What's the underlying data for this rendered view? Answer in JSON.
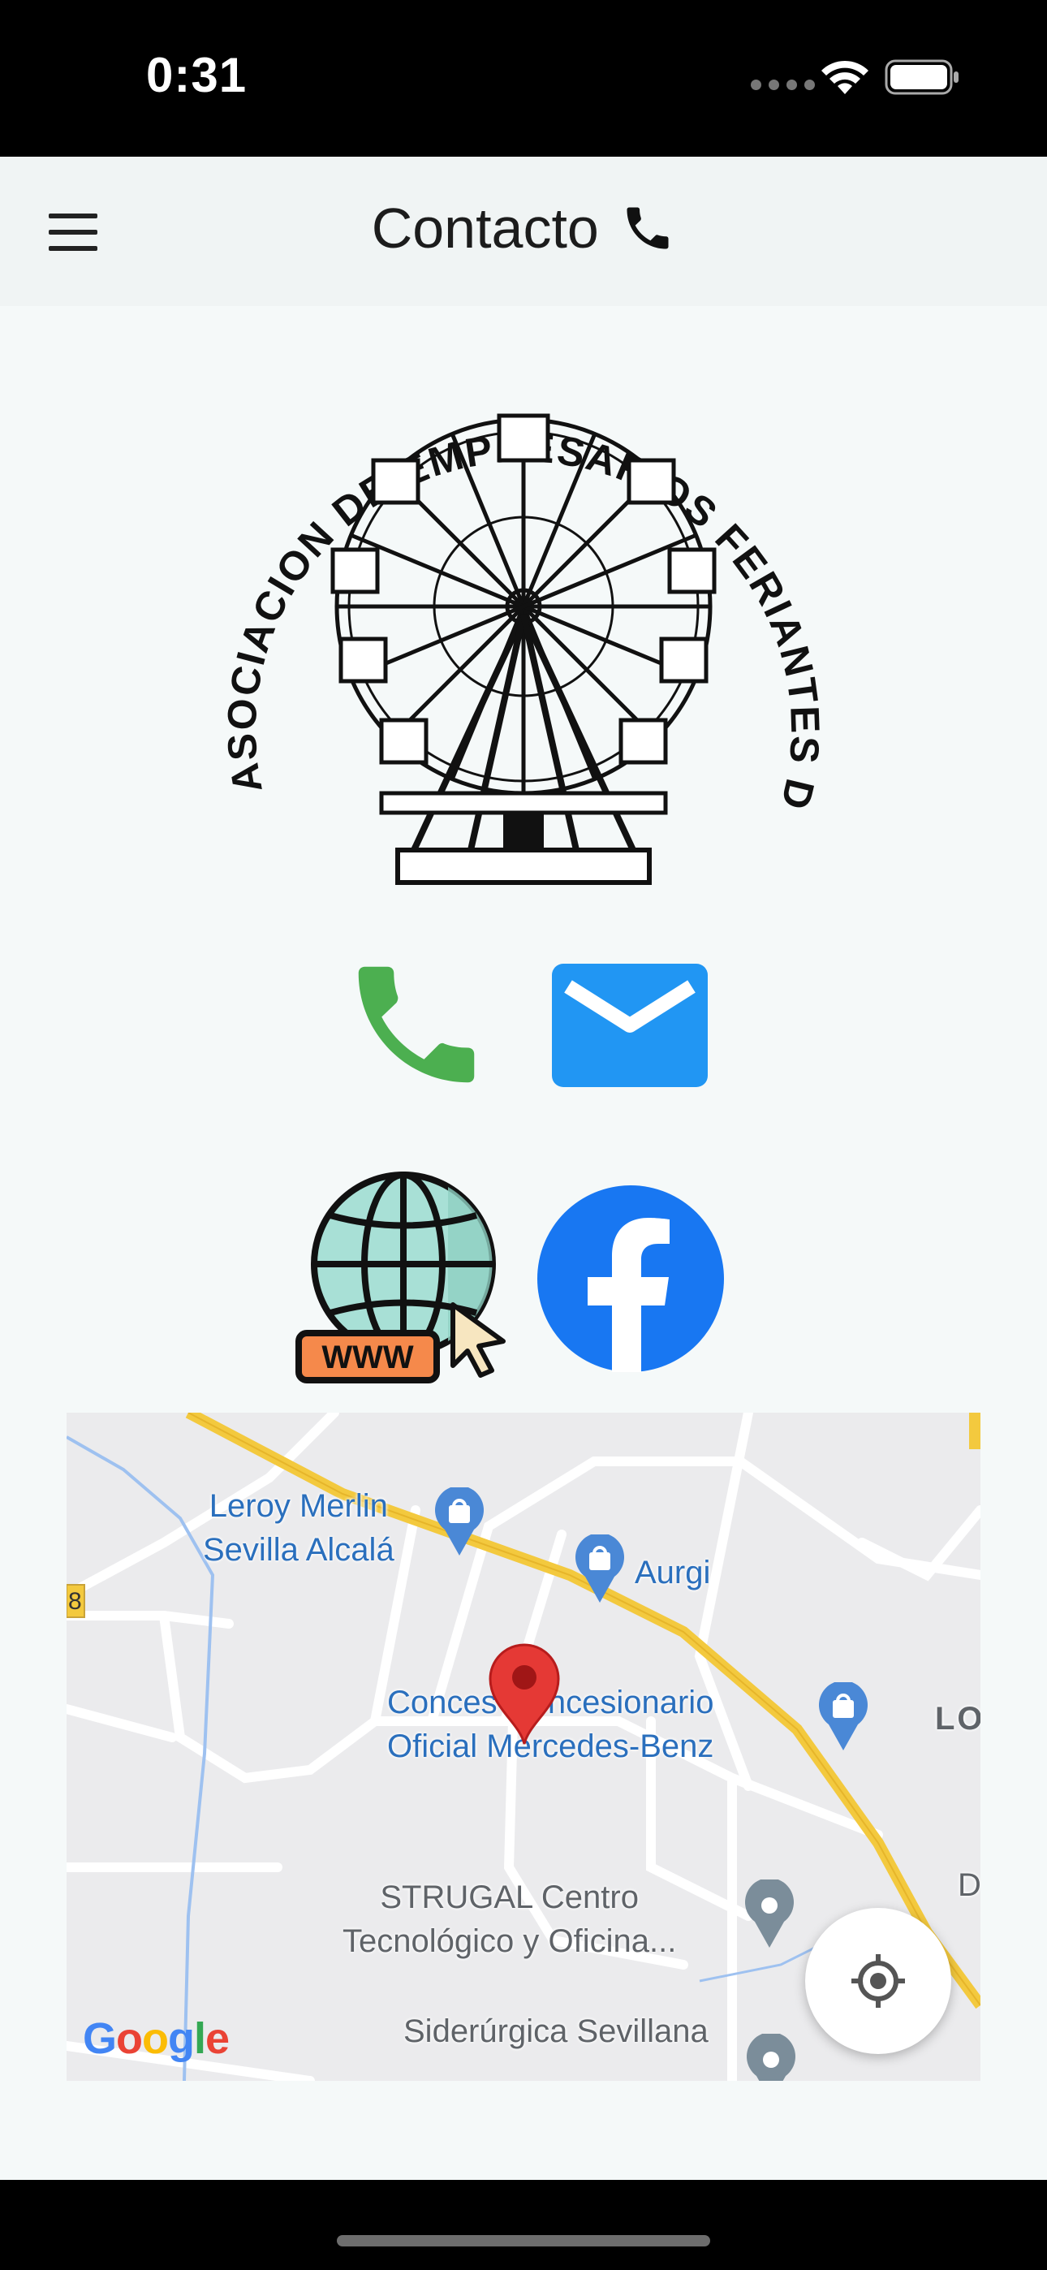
{
  "status_bar": {
    "time": "0:31"
  },
  "app_bar": {
    "title": "Contacto"
  },
  "logo": {
    "text": "ASOCIACION DE EMPRESARIOS FERIANTES DE ANDALUCIA, CEUTA Y MELILLA"
  },
  "contact_icons": {
    "phone": "phone-icon",
    "email": "mail-icon",
    "website": "www-globe-icon",
    "website_badge": "WWW",
    "facebook": "facebook-icon"
  },
  "map": {
    "labels": {
      "leroy_line1": "Leroy Merlin",
      "leroy_line2": "Sevilla Alcalá",
      "aurgi": "Aurgi",
      "conces_line1": "Conces  Concesionario",
      "conces_line2": "Oficial Mercedes-Benz",
      "strugal_line1": "STRUGAL Centro",
      "strugal_line2": "Tecnológico y Oficina...",
      "siderurgica": "Siderúrgica Sevillana",
      "lo": "LO",
      "d": "D",
      "road_8": "8"
    },
    "attribution": "Google",
    "colors": {
      "highway": "#f3c93e",
      "poi_blue": "#4a88d6",
      "pin_red": "#e53935"
    }
  }
}
